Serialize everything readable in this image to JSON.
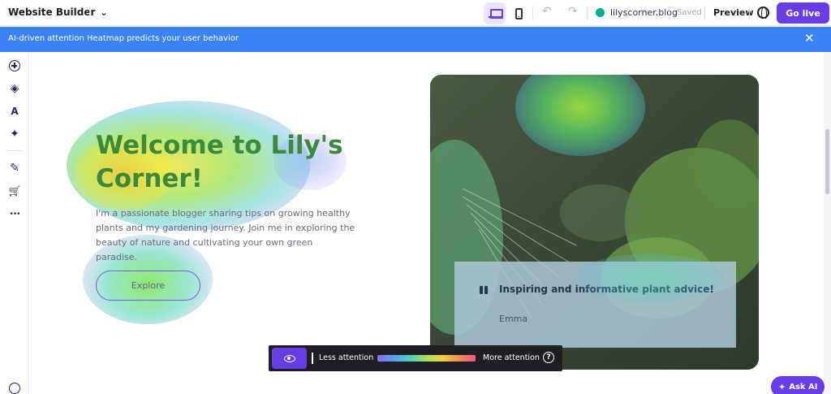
{
  "topbar": {
    "app_title": "Website Builder",
    "domain": "lilyscorner.blog",
    "saved_label": "Saved",
    "preview_label": "Preview",
    "golive_label": "Go live",
    "status_color": "#00b090",
    "icons": {
      "app_menu": "chevron-down-icon",
      "desktop": "laptop-icon",
      "mobile": "phone-icon",
      "undo": "undo-icon",
      "redo": "redo-icon",
      "language": "globe-icon"
    }
  },
  "banner": {
    "text": "AI-driven attention Heatmap predicts your user behavior",
    "color": "#3b82f6",
    "close_icon": "close-icon"
  },
  "sidebar": {
    "items": [
      {
        "name": "add-element",
        "icon": "plus-circle-icon",
        "glyph": ""
      },
      {
        "name": "layers",
        "icon": "layers-icon",
        "glyph": "◈"
      },
      {
        "name": "styles",
        "icon": "styles-icon",
        "glyph": "A"
      },
      {
        "name": "ai-tools",
        "icon": "sparkle-icon",
        "glyph": "✦"
      },
      {
        "name": "blog",
        "icon": "edit-icon",
        "glyph": "✎"
      },
      {
        "name": "store",
        "icon": "cart-icon",
        "glyph": "🛒"
      },
      {
        "name": "more",
        "icon": "more-icon",
        "glyph": "•••"
      }
    ]
  },
  "hero": {
    "title": "Welcome to Lily's Corner!",
    "text": "I'm a passionate blogger sharing tips on growing healthy plants and my gardening journey. Join me in exploring the beauty of nature and cultivating your own green paradise.",
    "button_label": "Explore"
  },
  "testimonial": {
    "quote": "Inspiring and informative plant advice!",
    "author": "Emma",
    "icon": "quote-icon"
  },
  "heatmap_legend": {
    "toggle_icon": "eye-icon",
    "less_label": "Less attention",
    "more_label": "More attention",
    "help_glyph": "?"
  },
  "ask_ai": {
    "label": "Ask AI",
    "icon": "sparkle-icon"
  },
  "colors": {
    "accent": "#673de6",
    "banner": "#3b82f6"
  }
}
